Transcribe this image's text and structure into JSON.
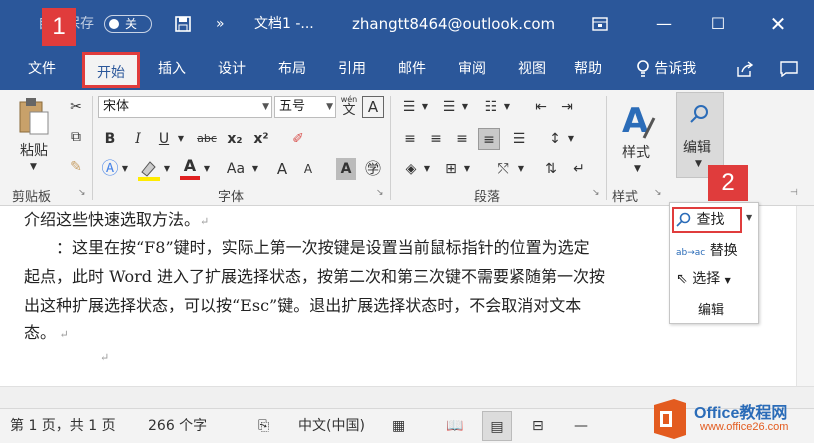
{
  "titlebar": {
    "autosave_label": "自动保存",
    "autosave_state": "关",
    "doc_title": "文档1 -...",
    "account": "zhangtt8464@outlook.com",
    "more": "»"
  },
  "tabs": [
    "文件",
    "开始",
    "插入",
    "设计",
    "布局",
    "引用",
    "邮件",
    "审阅",
    "视图",
    "帮助"
  ],
  "tell_me": "告诉我",
  "badges": {
    "one": "1",
    "two": "2"
  },
  "ribbon": {
    "paste": "粘贴",
    "clipboard": "剪贴板",
    "font_name": "宋体",
    "font_size": "五号",
    "font_group": "字体",
    "para_group": "段落",
    "styles_btn": "样式",
    "styles_group": "样式",
    "edit_btn": "编辑",
    "wen": "wén",
    "wen_char": "文",
    "A_box": "A",
    "bold": "B",
    "italic": "I",
    "underline": "U",
    "strike": "abc",
    "sub": "x₂",
    "sup": "x²",
    "aa": "Aa",
    "grow": "A",
    "shrink": "A"
  },
  "doc": {
    "line1": "介绍这些快速选取方法。",
    "line2": "：这里在按“F8”键时，实际上第一次按键是设置当前鼠标指针的位置为选定",
    "line3": "起点，此时 Word 进入了扩展选择状态，按第二次和第三次键不需要紧随第一次按",
    "line4": "出这种扩展选择状态，可以按“Esc”键。退出扩展选择状态时，不会取消对文本",
    "line5": "态。"
  },
  "dropdown": {
    "find": "查找",
    "replace": "替换",
    "select": "选择",
    "edit": "编辑"
  },
  "status": {
    "page": "第 1 页，共 1 页",
    "words": "266 个字",
    "lang": "中文(中国)"
  },
  "logo": {
    "brand": "Office教程网",
    "url": "www.office26.com"
  },
  "colors": {
    "accent": "#2b579a",
    "highlight": "#e03c3c"
  }
}
